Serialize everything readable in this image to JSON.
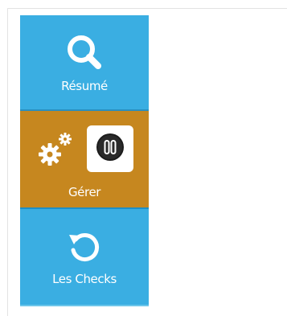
{
  "sidebar": {
    "items": [
      {
        "label": "Résumé",
        "icon": "search-icon",
        "state": "default"
      },
      {
        "label": "Gérer",
        "icon": "gears-icon",
        "state": "active",
        "badge_icon": "pause-toggle-icon"
      },
      {
        "label": "Les Checks",
        "icon": "refresh-icon",
        "state": "default"
      }
    ]
  },
  "colors": {
    "nav_blue": "#3aaee2",
    "nav_active": "#c6871f",
    "text": "#ffffff"
  }
}
